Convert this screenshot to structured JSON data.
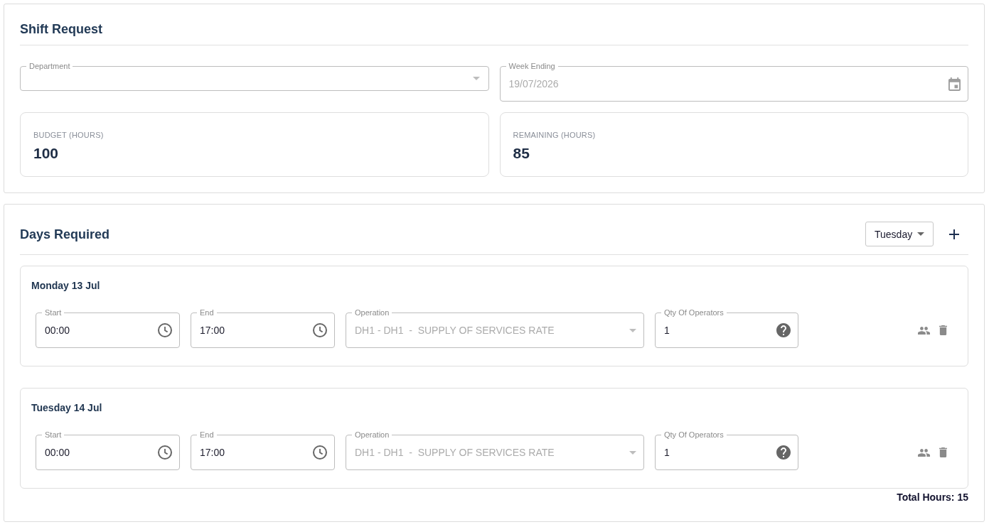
{
  "shift_request": {
    "title": "Shift Request",
    "department": {
      "kind": "select",
      "label": "Department"
    },
    "week_ending": {
      "kind": "date",
      "label": "Week Ending",
      "value": "19/07/2026",
      "disabled": true
    },
    "stats": [
      {
        "label": "BUDGET (HOURS)",
        "value": "100"
      },
      {
        "label": "REMAINING (HOURS)",
        "value": "85"
      }
    ]
  },
  "days_required": {
    "title": "Days Required",
    "day_select": {
      "value": "Tuesday"
    },
    "days": [
      {
        "title": "Monday 13 Jul",
        "fields": [
          {
            "kind": "time",
            "label": "Start",
            "value": "00:00",
            "disabled": false
          },
          {
            "kind": "time",
            "label": "End",
            "value": "17:00",
            "disabled": false
          },
          {
            "kind": "select",
            "label": "Operation",
            "value": "DH1 - DH1  -  SUPPLY OF SERVICES RATE",
            "disabled": true
          },
          {
            "kind": "number",
            "label": "Qty Of Operators",
            "value": "1",
            "disabled": false
          }
        ]
      },
      {
        "title": "Tuesday 14 Jul",
        "fields": [
          {
            "kind": "time",
            "label": "Start",
            "value": "00:00",
            "disabled": false
          },
          {
            "kind": "time",
            "label": "End",
            "value": "17:00",
            "disabled": false
          },
          {
            "kind": "select",
            "label": "Operation",
            "value": "DH1 - DH1  -  SUPPLY OF SERVICES RATE",
            "disabled": true
          },
          {
            "kind": "number",
            "label": "Qty Of Operators",
            "value": "1",
            "disabled": false
          }
        ]
      }
    ],
    "total_hours": "Total Hours: 15"
  }
}
